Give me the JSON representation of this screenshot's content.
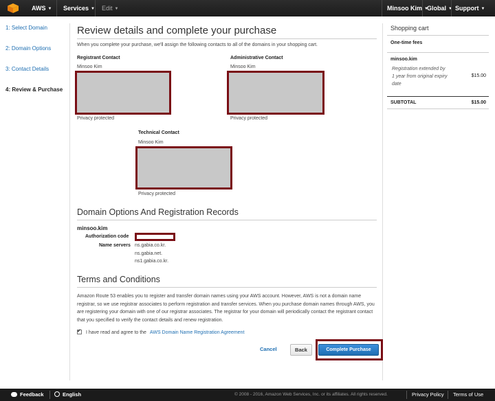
{
  "topbar": {
    "brand": "AWS",
    "services": "Services",
    "edit": "Edit",
    "user": "Minsoo Kim",
    "region": "Global",
    "support": "Support"
  },
  "steps": [
    {
      "label": "1: Select Domain"
    },
    {
      "label": "2: Domain Options"
    },
    {
      "label": "3: Contact Details"
    },
    {
      "label": "4: Review & Purchase"
    }
  ],
  "main": {
    "title": "Review details and complete your purchase",
    "intro": "When you complete your purchase, we'll assign the following contacts to all of the domains in your shopping cart.",
    "registrant": {
      "heading": "Registrant Contact",
      "name": "Minsoo Kim",
      "privacy": "Privacy protected"
    },
    "admin": {
      "heading": "Administrative Contact",
      "name": "Minsoo Kim",
      "privacy": "Privacy protected"
    },
    "technical": {
      "heading": "Technical Contact",
      "name": "Minsoo Kim",
      "privacy": "Privacy protected"
    },
    "options_heading": "Domain Options And Registration Records",
    "domain": "minsoo.kim",
    "auth_label": "Authorization code",
    "ns_label": "Name servers",
    "name_servers": [
      "ns.gabia.co.kr.",
      "ns.gabia.net.",
      "ns1.gabia.co.kr."
    ],
    "terms_heading": "Terms and Conditions",
    "terms_text": "Amazon Route 53 enables you to register and transfer domain names using your AWS account. However, AWS is not a domain name registrar, so we use registrar associates to perform registration and transfer services. When you purchase domain names through AWS, you are registering your domain with one of our registrar associates. The registrar for your domain will periodically contact the registrant contact that you specified to verify the contact details and renew registration.",
    "agree_text": "I have read and agree to the",
    "agree_link": "AWS Domain Name Registration Agreement",
    "cancel": "Cancel",
    "back": "Back",
    "complete": "Complete Purchase"
  },
  "cart": {
    "title": "Shopping cart",
    "section": "One-time fees",
    "domain": "minsoo.kim",
    "desc_lines": [
      "Registration extended by",
      "1 year from original expiry",
      "date"
    ],
    "price": "$15.00",
    "subtotal_label": "SUBTOTAL",
    "subtotal": "$15.00"
  },
  "footer": {
    "feedback": "Feedback",
    "language": "English",
    "copyright": "© 2008 - 2016, Amazon Web Services, Inc. or its affiliates. All rights reserved.",
    "privacy": "Privacy Policy",
    "terms": "Terms of Use"
  },
  "colors": {
    "redaction_border": "#7a0e15",
    "redaction_fill": "#c8c8c8",
    "link": "#1f6fb2",
    "primary_button": "#1f6fb2",
    "nav_bg": "#1b1b1b"
  }
}
